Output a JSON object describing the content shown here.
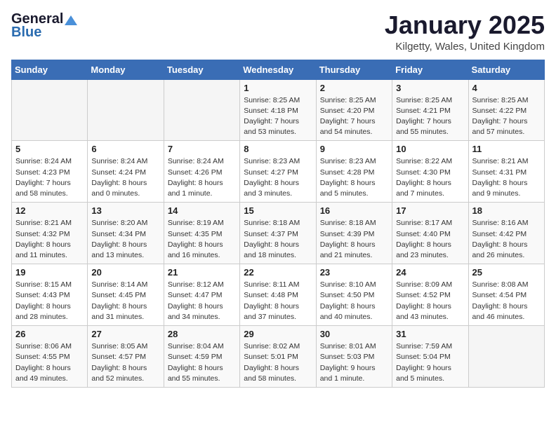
{
  "header": {
    "logo_general": "General",
    "logo_blue": "Blue",
    "month": "January 2025",
    "location": "Kilgetty, Wales, United Kingdom"
  },
  "weekdays": [
    "Sunday",
    "Monday",
    "Tuesday",
    "Wednesday",
    "Thursday",
    "Friday",
    "Saturday"
  ],
  "weeks": [
    [
      {
        "day": "",
        "info": ""
      },
      {
        "day": "",
        "info": ""
      },
      {
        "day": "",
        "info": ""
      },
      {
        "day": "1",
        "info": "Sunrise: 8:25 AM\nSunset: 4:18 PM\nDaylight: 7 hours\nand 53 minutes."
      },
      {
        "day": "2",
        "info": "Sunrise: 8:25 AM\nSunset: 4:20 PM\nDaylight: 7 hours\nand 54 minutes."
      },
      {
        "day": "3",
        "info": "Sunrise: 8:25 AM\nSunset: 4:21 PM\nDaylight: 7 hours\nand 55 minutes."
      },
      {
        "day": "4",
        "info": "Sunrise: 8:25 AM\nSunset: 4:22 PM\nDaylight: 7 hours\nand 57 minutes."
      }
    ],
    [
      {
        "day": "5",
        "info": "Sunrise: 8:24 AM\nSunset: 4:23 PM\nDaylight: 7 hours\nand 58 minutes."
      },
      {
        "day": "6",
        "info": "Sunrise: 8:24 AM\nSunset: 4:24 PM\nDaylight: 8 hours\nand 0 minutes."
      },
      {
        "day": "7",
        "info": "Sunrise: 8:24 AM\nSunset: 4:26 PM\nDaylight: 8 hours\nand 1 minute."
      },
      {
        "day": "8",
        "info": "Sunrise: 8:23 AM\nSunset: 4:27 PM\nDaylight: 8 hours\nand 3 minutes."
      },
      {
        "day": "9",
        "info": "Sunrise: 8:23 AM\nSunset: 4:28 PM\nDaylight: 8 hours\nand 5 minutes."
      },
      {
        "day": "10",
        "info": "Sunrise: 8:22 AM\nSunset: 4:30 PM\nDaylight: 8 hours\nand 7 minutes."
      },
      {
        "day": "11",
        "info": "Sunrise: 8:21 AM\nSunset: 4:31 PM\nDaylight: 8 hours\nand 9 minutes."
      }
    ],
    [
      {
        "day": "12",
        "info": "Sunrise: 8:21 AM\nSunset: 4:32 PM\nDaylight: 8 hours\nand 11 minutes."
      },
      {
        "day": "13",
        "info": "Sunrise: 8:20 AM\nSunset: 4:34 PM\nDaylight: 8 hours\nand 13 minutes."
      },
      {
        "day": "14",
        "info": "Sunrise: 8:19 AM\nSunset: 4:35 PM\nDaylight: 8 hours\nand 16 minutes."
      },
      {
        "day": "15",
        "info": "Sunrise: 8:18 AM\nSunset: 4:37 PM\nDaylight: 8 hours\nand 18 minutes."
      },
      {
        "day": "16",
        "info": "Sunrise: 8:18 AM\nSunset: 4:39 PM\nDaylight: 8 hours\nand 21 minutes."
      },
      {
        "day": "17",
        "info": "Sunrise: 8:17 AM\nSunset: 4:40 PM\nDaylight: 8 hours\nand 23 minutes."
      },
      {
        "day": "18",
        "info": "Sunrise: 8:16 AM\nSunset: 4:42 PM\nDaylight: 8 hours\nand 26 minutes."
      }
    ],
    [
      {
        "day": "19",
        "info": "Sunrise: 8:15 AM\nSunset: 4:43 PM\nDaylight: 8 hours\nand 28 minutes."
      },
      {
        "day": "20",
        "info": "Sunrise: 8:14 AM\nSunset: 4:45 PM\nDaylight: 8 hours\nand 31 minutes."
      },
      {
        "day": "21",
        "info": "Sunrise: 8:12 AM\nSunset: 4:47 PM\nDaylight: 8 hours\nand 34 minutes."
      },
      {
        "day": "22",
        "info": "Sunrise: 8:11 AM\nSunset: 4:48 PM\nDaylight: 8 hours\nand 37 minutes."
      },
      {
        "day": "23",
        "info": "Sunrise: 8:10 AM\nSunset: 4:50 PM\nDaylight: 8 hours\nand 40 minutes."
      },
      {
        "day": "24",
        "info": "Sunrise: 8:09 AM\nSunset: 4:52 PM\nDaylight: 8 hours\nand 43 minutes."
      },
      {
        "day": "25",
        "info": "Sunrise: 8:08 AM\nSunset: 4:54 PM\nDaylight: 8 hours\nand 46 minutes."
      }
    ],
    [
      {
        "day": "26",
        "info": "Sunrise: 8:06 AM\nSunset: 4:55 PM\nDaylight: 8 hours\nand 49 minutes."
      },
      {
        "day": "27",
        "info": "Sunrise: 8:05 AM\nSunset: 4:57 PM\nDaylight: 8 hours\nand 52 minutes."
      },
      {
        "day": "28",
        "info": "Sunrise: 8:04 AM\nSunset: 4:59 PM\nDaylight: 8 hours\nand 55 minutes."
      },
      {
        "day": "29",
        "info": "Sunrise: 8:02 AM\nSunset: 5:01 PM\nDaylight: 8 hours\nand 58 minutes."
      },
      {
        "day": "30",
        "info": "Sunrise: 8:01 AM\nSunset: 5:03 PM\nDaylight: 9 hours\nand 1 minute."
      },
      {
        "day": "31",
        "info": "Sunrise: 7:59 AM\nSunset: 5:04 PM\nDaylight: 9 hours\nand 5 minutes."
      },
      {
        "day": "",
        "info": ""
      }
    ]
  ]
}
